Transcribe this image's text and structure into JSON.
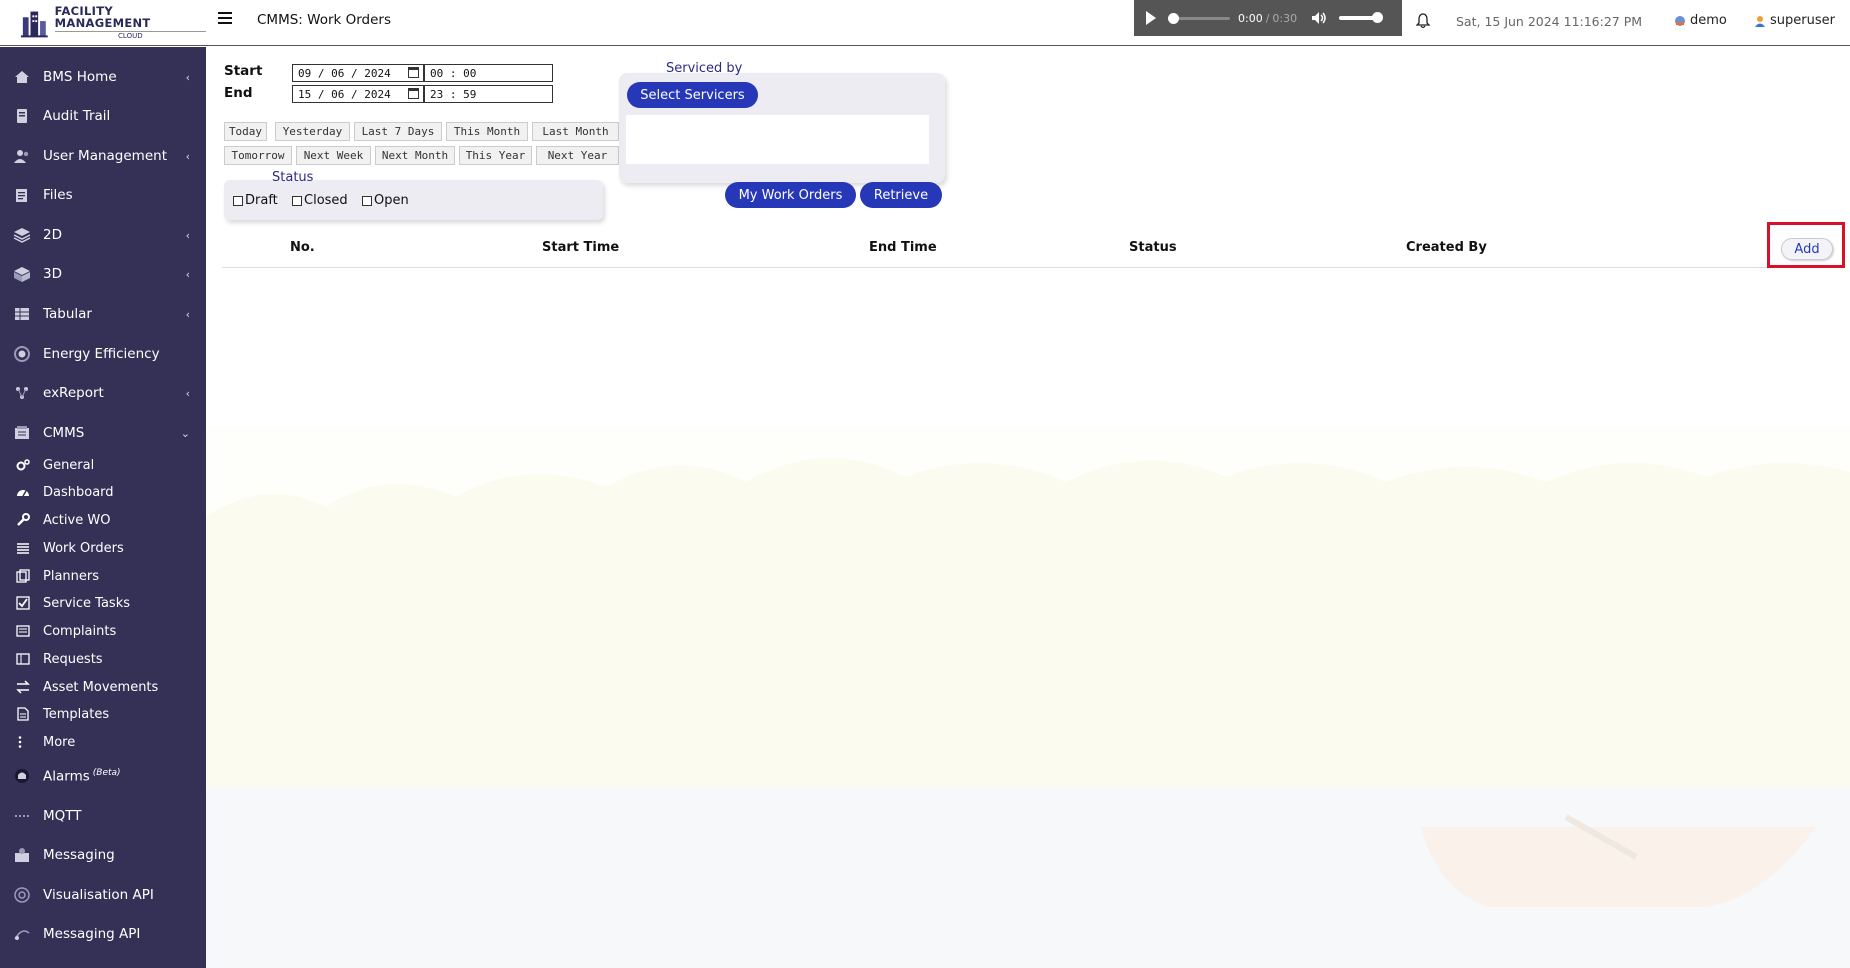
{
  "app": {
    "logo_line1": "FACILITY MANAGEMENT",
    "logo_line2": "CLOUD",
    "page_title": "CMMS: Work Orders"
  },
  "audio": {
    "current": "0:00",
    "separator": "/",
    "duration": "0:30"
  },
  "header": {
    "datetime": "Sat, 15 Jun 2024 11:16:27 PM",
    "site": "demo",
    "user": "superuser"
  },
  "sidebar": {
    "items": [
      {
        "label": "BMS Home",
        "icon": "home-icon",
        "chevron": "‹"
      },
      {
        "label": "Audit Trail",
        "icon": "audit-icon",
        "chevron": ""
      },
      {
        "label": "User Management",
        "icon": "users-icon",
        "chevron": "‹"
      },
      {
        "label": "Files",
        "icon": "files-icon",
        "chevron": ""
      },
      {
        "label": "2D",
        "icon": "layers-icon",
        "chevron": "‹"
      },
      {
        "label": "3D",
        "icon": "cube-icon",
        "chevron": "‹"
      },
      {
        "label": "Tabular",
        "icon": "table-icon",
        "chevron": "‹"
      },
      {
        "label": "Energy Efficiency",
        "icon": "energy-icon",
        "chevron": ""
      },
      {
        "label": "exReport",
        "icon": "report-icon",
        "chevron": "‹"
      },
      {
        "label": "CMMS",
        "icon": "cmms-icon",
        "chevron": "⌄"
      }
    ],
    "cmms_sub": [
      {
        "label": "General",
        "icon": "cogs-icon"
      },
      {
        "label": "Dashboard",
        "icon": "dashboard-icon"
      },
      {
        "label": "Active WO",
        "icon": "wrench-icon"
      },
      {
        "label": "Work Orders",
        "icon": "list-icon"
      },
      {
        "label": "Planners",
        "icon": "planner-icon"
      },
      {
        "label": "Service Tasks",
        "icon": "check-square-icon"
      },
      {
        "label": "Complaints",
        "icon": "complaint-icon"
      },
      {
        "label": "Requests",
        "icon": "request-icon"
      },
      {
        "label": "Asset Movements",
        "icon": "exchange-icon"
      },
      {
        "label": "Templates",
        "icon": "template-icon"
      },
      {
        "label": "More",
        "icon": "more-icon"
      }
    ],
    "bottom_items": [
      {
        "label": "Alarms",
        "icon": "alarm-icon",
        "badge": "(Beta)"
      },
      {
        "label": "MQTT",
        "icon": "mqtt-icon"
      },
      {
        "label": "Messaging",
        "icon": "messaging-icon"
      },
      {
        "label": "Visualisation API",
        "icon": "api-icon"
      },
      {
        "label": "Messaging API",
        "icon": "messaging-api-icon"
      }
    ]
  },
  "filters": {
    "start_label": "Start",
    "end_label": "End",
    "start_date": "09 / 06 / 2024",
    "start_time": "00 : 00",
    "end_date": "15 / 06 / 2024",
    "end_time": "23 : 59",
    "quick_row1": [
      "Today",
      "Yesterday",
      "Last 7 Days",
      "This Month",
      "Last Month"
    ],
    "quick_row2": [
      "Tomorrow",
      "Next Week",
      "Next Month",
      "This Year",
      "Next Year"
    ],
    "status_title": "Status",
    "status_options": [
      "Draft",
      "Closed",
      "Open"
    ]
  },
  "servicers": {
    "title": "Serviced by",
    "select_button": "Select Servicers"
  },
  "actions": {
    "my_work_orders": "My Work Orders",
    "retrieve": "Retrieve"
  },
  "table": {
    "columns": [
      "No.",
      "Start Time",
      "End Time",
      "Status",
      "Created By"
    ],
    "add_button": "Add",
    "rows": []
  },
  "colors": {
    "sidebar_bg": "#343056",
    "accent": "#2637b8",
    "highlight": "#d9102a"
  }
}
